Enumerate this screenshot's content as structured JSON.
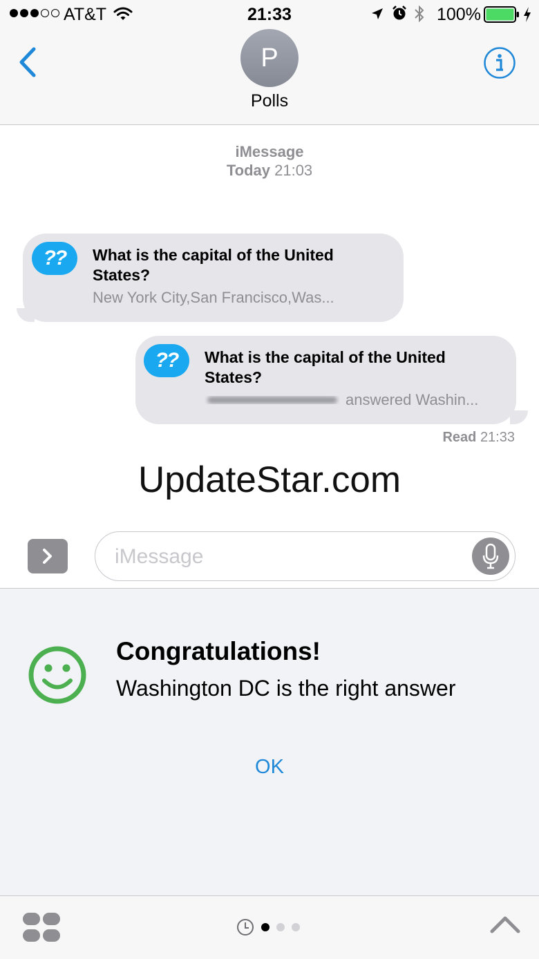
{
  "status_bar": {
    "carrier": "AT&T",
    "time": "21:33",
    "battery": "100%",
    "signal_bars_filled": 3,
    "signal_bars_total": 5
  },
  "header": {
    "avatar_initial": "P",
    "contact_name": "Polls"
  },
  "conversation": {
    "service": "iMessage",
    "date_label": "Today",
    "date_time": "21:03"
  },
  "messages": [
    {
      "icon_text": "??",
      "title": "What is the capital of the United States?",
      "subtitle": "New York City,San Francisco,Was..."
    },
    {
      "icon_text": "??",
      "title": "What is the capital of the United States?",
      "subtitle": "answered Washin..."
    }
  ],
  "read_receipt": {
    "label": "Read",
    "time": "21:33"
  },
  "watermark": "UpdateStar.com",
  "input": {
    "placeholder": "iMessage"
  },
  "drawer": {
    "title": "Congratulations!",
    "message": "Washington DC is the right answer",
    "ok_label": "OK"
  },
  "colors": {
    "accent": "#1f88d8",
    "bubble": "#e5e5ea",
    "poll_icon": "#1aa9f0",
    "smiley": "#4caf50",
    "battery": "#4cd964"
  },
  "icons": [
    "back-chevron-icon",
    "info-icon",
    "wifi-icon",
    "location-icon",
    "alarm-icon",
    "bluetooth-icon",
    "battery-icon",
    "charging-icon",
    "chevron-right-icon",
    "microphone-icon",
    "smiley-icon",
    "app-grid-icon",
    "recents-clock-icon",
    "chevron-up-icon"
  ]
}
